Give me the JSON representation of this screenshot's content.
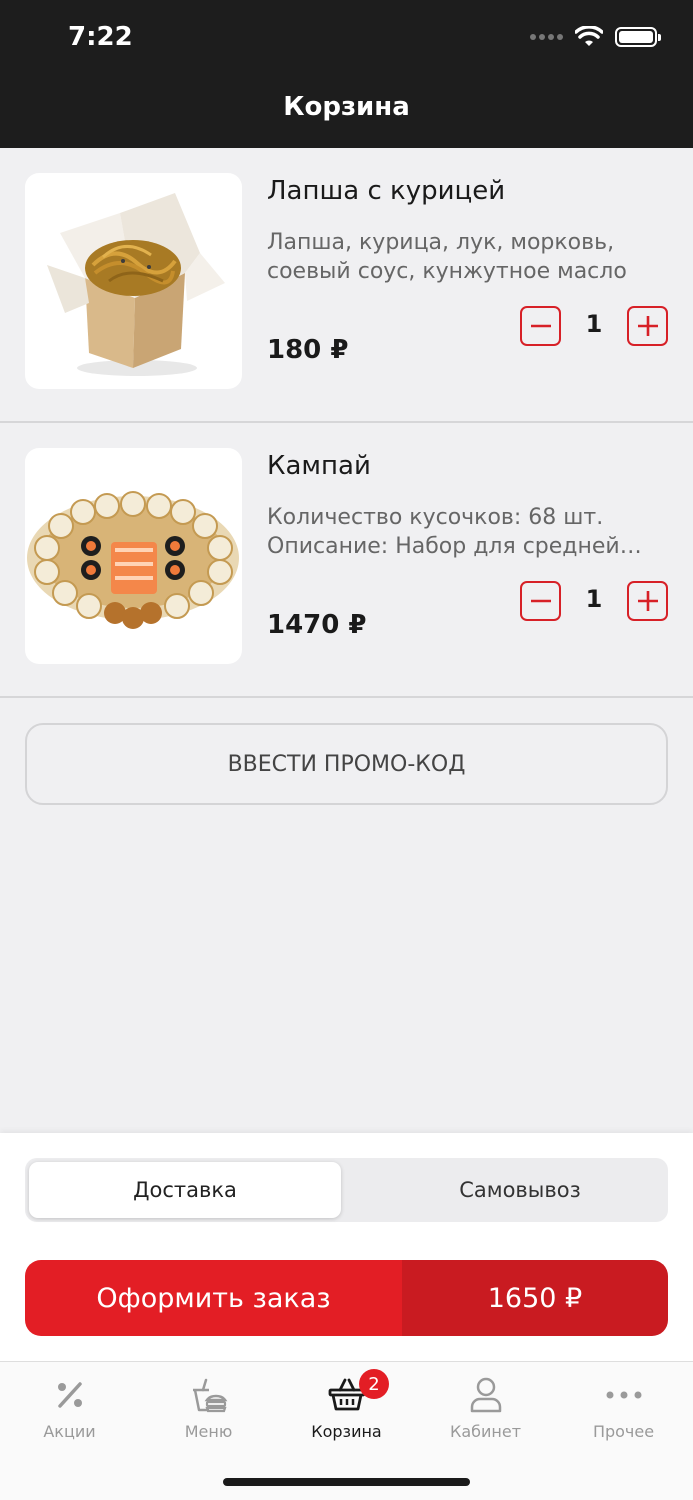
{
  "status_bar": {
    "time": "7:22"
  },
  "header": {
    "title": "Корзина"
  },
  "cart": {
    "items": [
      {
        "name": "Лапша с курицей",
        "desc_line1": "Лапша, курица, лук, морковь,",
        "desc_line2": "соевый соус, кунжутное масло",
        "price": "180 ₽",
        "qty": "1",
        "image_icon": "noodle-box-icon"
      },
      {
        "name": "Кампай",
        "desc_line1": "Количество кусочков: 68 шт.",
        "desc_line2": "Описание: Набор для средней…",
        "price": "1470 ₽",
        "qty": "1",
        "image_icon": "sushi-set-icon"
      }
    ],
    "promo_label": "ВВЕСТИ ПРОМО-КОД"
  },
  "delivery": {
    "options": [
      "Доставка",
      "Самовывоз"
    ],
    "selected": "Доставка"
  },
  "order": {
    "label": "Оформить заказ",
    "total": "1650 ₽"
  },
  "tabbar": {
    "tabs": [
      {
        "label": "Акции",
        "icon": "percent-icon"
      },
      {
        "label": "Меню",
        "icon": "menu-food-icon"
      },
      {
        "label": "Корзина",
        "icon": "basket-icon",
        "badge": "2",
        "active": true
      },
      {
        "label": "Кабинет",
        "icon": "user-icon"
      },
      {
        "label": "Прочее",
        "icon": "more-dots-icon"
      }
    ]
  },
  "colors": {
    "accent": "#e31e25",
    "accent_dark": "#c91b21",
    "header_bg": "#1d1d1d"
  }
}
